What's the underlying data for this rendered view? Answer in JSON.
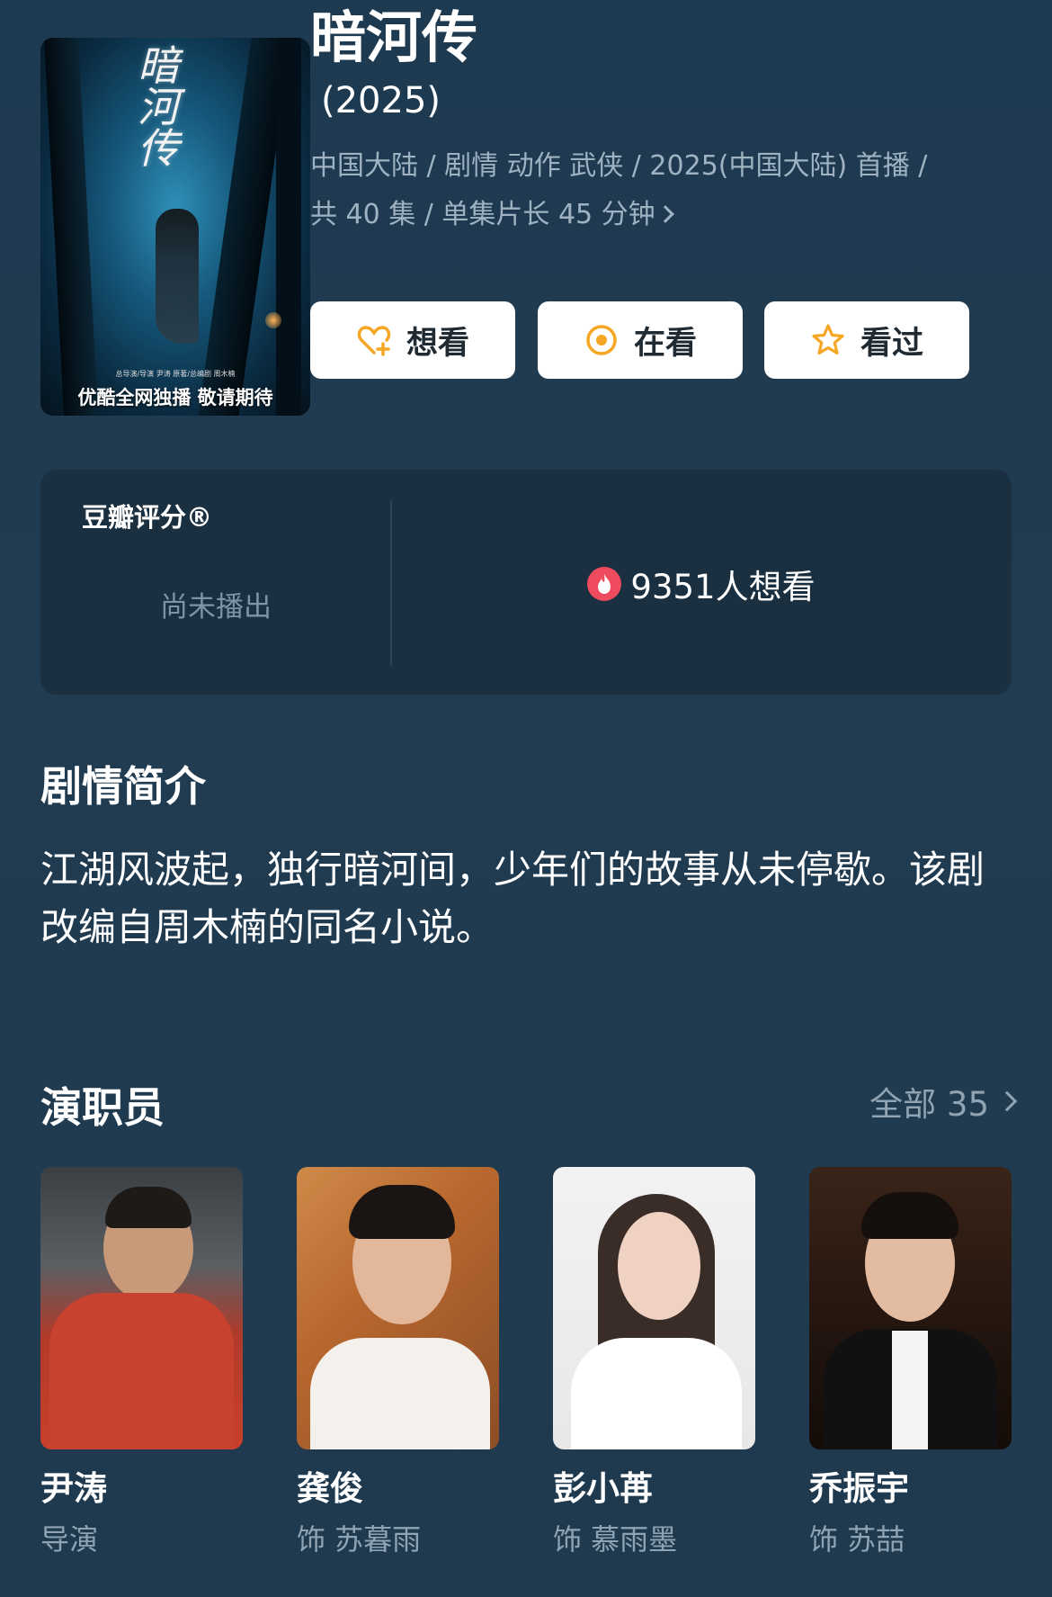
{
  "show": {
    "title": "暗河传",
    "year": "(2025)",
    "meta_line1": "中国大陆 / 剧情 动作 武侠 / 2025(中国大陆) 首播 /",
    "meta_line2": "共 40 集 / 单集片长 45 分钟",
    "poster": {
      "title_art": "暗河传",
      "credits": "总导演/导演 尹涛   原著/总编剧 周木楠",
      "slogan": "优酷全网独播 敬请期待"
    }
  },
  "actions": [
    {
      "label": "想看",
      "icon": "heart-plus-icon"
    },
    {
      "label": "在看",
      "icon": "target-icon"
    },
    {
      "label": "看过",
      "icon": "star-icon"
    }
  ],
  "rating": {
    "label": "豆瓣评分®",
    "status": "尚未播出",
    "wish_count": "9351人想看"
  },
  "synopsis": {
    "heading": "剧情简介",
    "text": "江湖风波起，独行暗河间，少年们的故事从未停歇。该剧改编自周木楠的同名小说。"
  },
  "cast": {
    "heading": "演职员",
    "all_label": "全部 35",
    "members": [
      {
        "name": "尹涛",
        "role": "导演"
      },
      {
        "name": "龚俊",
        "role": "饰 苏暮雨"
      },
      {
        "name": "彭小苒",
        "role": "饰 慕雨墨"
      },
      {
        "name": "乔振宇",
        "role": "饰 苏喆"
      }
    ]
  },
  "colors": {
    "background": "#1f3a4f",
    "panel": "#1a2f40",
    "accent": "#f5a623",
    "muted": "#8fa3b2",
    "fire": "#ef4b5f"
  }
}
